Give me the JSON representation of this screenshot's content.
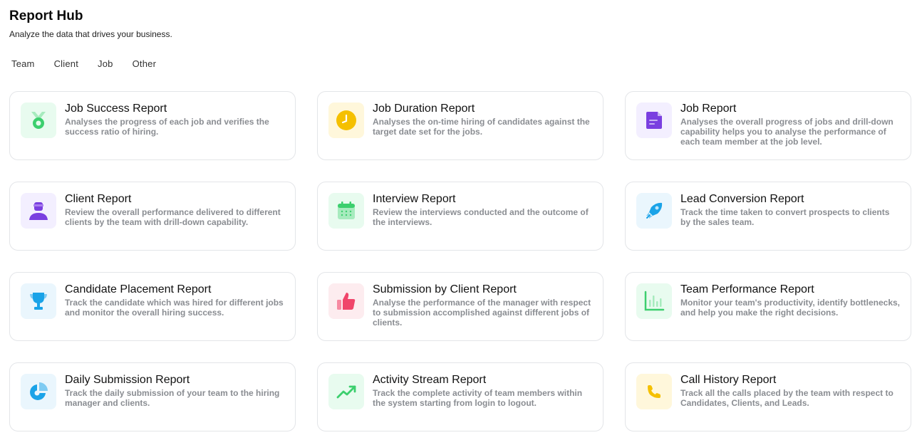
{
  "header": {
    "title": "Report Hub",
    "subtitle": "Analyze the data that drives your business."
  },
  "tabs": [
    "Team",
    "Client",
    "Job",
    "Other"
  ],
  "cards": [
    {
      "title": "Job Success Report",
      "desc": "Analyses the progress of each job and verifies the success ratio of hiring.",
      "icon": "medal-icon",
      "bg": "#e8fbef",
      "color": "#3ccf6e"
    },
    {
      "title": "Job Duration Report",
      "desc": "Analyses the on-time hiring of candidates against the target date set for the jobs.",
      "icon": "clock-icon",
      "bg": "#fff7db",
      "color": "#f5c000"
    },
    {
      "title": "Job Report",
      "desc": "Analyses the overall progress of jobs and drill-down capability helps you to analyse the performance of each team member at the job level.",
      "icon": "document-icon",
      "bg": "#f3efff",
      "color": "#7a3fe0"
    },
    {
      "title": "Client Report",
      "desc": "Review the overall performance delivered to different clients by the team with drill-down capability.",
      "icon": "user-icon",
      "bg": "#f3efff",
      "color": "#7a3fe0"
    },
    {
      "title": "Interview Report",
      "desc": "Review the interviews conducted and the outcome of the interviews.",
      "icon": "calendar-icon",
      "bg": "#e8fbef",
      "color": "#3ccf6e"
    },
    {
      "title": "Lead Conversion Report",
      "desc": "Track the time taken to convert prospects to clients by the sales team.",
      "icon": "rocket-icon",
      "bg": "#eaf6fd",
      "color": "#1aa3e8"
    },
    {
      "title": "Candidate Placement Report",
      "desc": "Track the candidate which was hired for different jobs and monitor the overall hiring success.",
      "icon": "trophy-icon",
      "bg": "#eaf6fd",
      "color": "#1aa3e8"
    },
    {
      "title": "Submission by Client Report",
      "desc": "Analyse the performance of the manager with respect to submission accomplished against different jobs of clients.",
      "icon": "thumbs-up-icon",
      "bg": "#fdecef",
      "color": "#f0456a"
    },
    {
      "title": "Team Performance Report",
      "desc": "Monitor your team's productivity, identify bottlenecks, and help you make the right decisions.",
      "icon": "bar-chart-icon",
      "bg": "#e8fbef",
      "color": "#3ccf6e"
    },
    {
      "title": "Daily Submission Report",
      "desc": "Track the daily submission of your team to the hiring manager and clients.",
      "icon": "pie-chart-icon",
      "bg": "#eaf6fd",
      "color": "#1aa3e8"
    },
    {
      "title": "Activity Stream Report",
      "desc": "Track the complete activity of team members within the system starting from login to logout.",
      "icon": "trend-up-icon",
      "bg": "#e8fbef",
      "color": "#3ccf6e"
    },
    {
      "title": "Call History Report",
      "desc": "Track all the calls placed by the team with respect to Candidates, Clients, and Leads.",
      "icon": "phone-icon",
      "bg": "#fff7db",
      "color": "#f5c000"
    }
  ]
}
